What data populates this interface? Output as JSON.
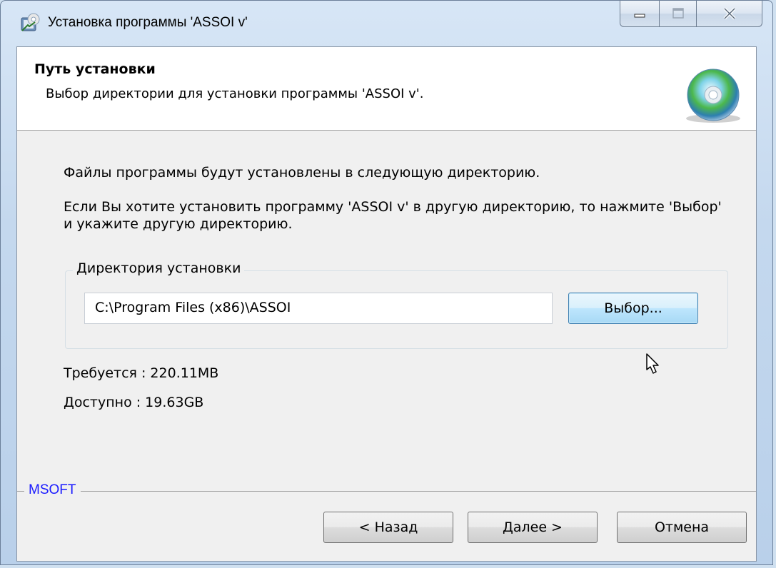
{
  "window": {
    "title": "Установка программы 'ASSOI v'",
    "controls": {
      "minimize": "minimize-icon",
      "maximize": "maximize-icon",
      "close": "close-icon"
    }
  },
  "header": {
    "title": "Путь установки",
    "subtitle": "Выбор директории для установки программы 'ASSOI v'."
  },
  "body": {
    "info_line": "Файлы программы будут установлены в следующую директорию.",
    "instructions": "Если Вы хотите установить программу 'ASSOI v' в другую директорию, то нажмите 'Выбор' и укажите другую директорию."
  },
  "install_dir": {
    "legend": "Директория установки",
    "path_value": "C:\\Program Files (x86)\\ASSOI",
    "browse_label": "Выбор..."
  },
  "space": {
    "required": "Требуется : 220.11MB",
    "available": "Доступно : 19.63GB"
  },
  "footer": {
    "brand": "MSOFT",
    "back_label": "< Назад",
    "next_label": "Далее >",
    "cancel_label": "Отмена"
  },
  "colors": {
    "brand": "#1a1aff",
    "accent_button": "#3c7fb1"
  }
}
